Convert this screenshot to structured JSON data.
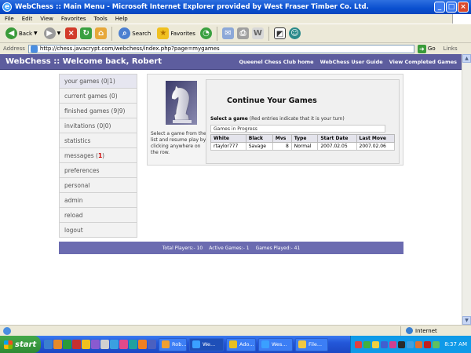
{
  "window": {
    "title": "WebChess :: Main Menu - Microsoft Internet Explorer provided by West Fraser Timber Co. Ltd."
  },
  "menu": [
    "File",
    "Edit",
    "View",
    "Favorites",
    "Tools",
    "Help"
  ],
  "toolbar": {
    "back": "Back",
    "search": "Search",
    "favorites": "Favorites"
  },
  "address": {
    "label": "Address",
    "url": "http://chess.javacrypt.com/webchess/index.php?page=mygames",
    "go": "Go",
    "links": "Links"
  },
  "site": {
    "title": "WebChess :: Welcome back, Robert",
    "links": [
      "Queenel Chess Club home",
      "WebChess User Guide",
      "View Completed Games"
    ]
  },
  "nav": [
    {
      "label": "your games (0|1)"
    },
    {
      "label": "current games (0)"
    },
    {
      "label": "finished games (9|9)"
    },
    {
      "label": "invitations (0|0)"
    },
    {
      "label": "statistics"
    },
    {
      "label": "messages (",
      "badge": "1",
      "suffix": ")"
    },
    {
      "label": "preferences"
    },
    {
      "label": "personal"
    },
    {
      "label": "admin"
    },
    {
      "label": "reload"
    },
    {
      "label": "logout"
    }
  ],
  "main": {
    "heading": "Continue Your Games",
    "select_bold": "Select a game",
    "select_note": "(Red entries indicate that it is your turn)",
    "help": "Select a game from the list and resume play by clicking anywhere on the row.",
    "games_in_progress": "Games in Progress",
    "columns": [
      "White",
      "Black",
      "Mvs",
      "Type",
      "Start Date",
      "Last Move"
    ],
    "rows": [
      [
        "rtaylor777",
        "Savage",
        "8",
        "Normal",
        "2007.02.05",
        "2007.02.06"
      ]
    ]
  },
  "footer": {
    "total_players": "Total Players:- 10",
    "active_games": "Active Games:- 1",
    "games_played": "Games Played:- 41"
  },
  "status": {
    "zone": "Internet"
  },
  "taskbar": {
    "start": "start",
    "tasks": [
      "Rob...",
      "We...",
      "Ado...",
      "Wes...",
      "File..."
    ],
    "clock": "8:37 AM"
  },
  "colors": {
    "site_header": "#5d5d9e",
    "footer": "#6b6bb0",
    "taskbar": "#2357d9",
    "start": "#2f8a33"
  }
}
